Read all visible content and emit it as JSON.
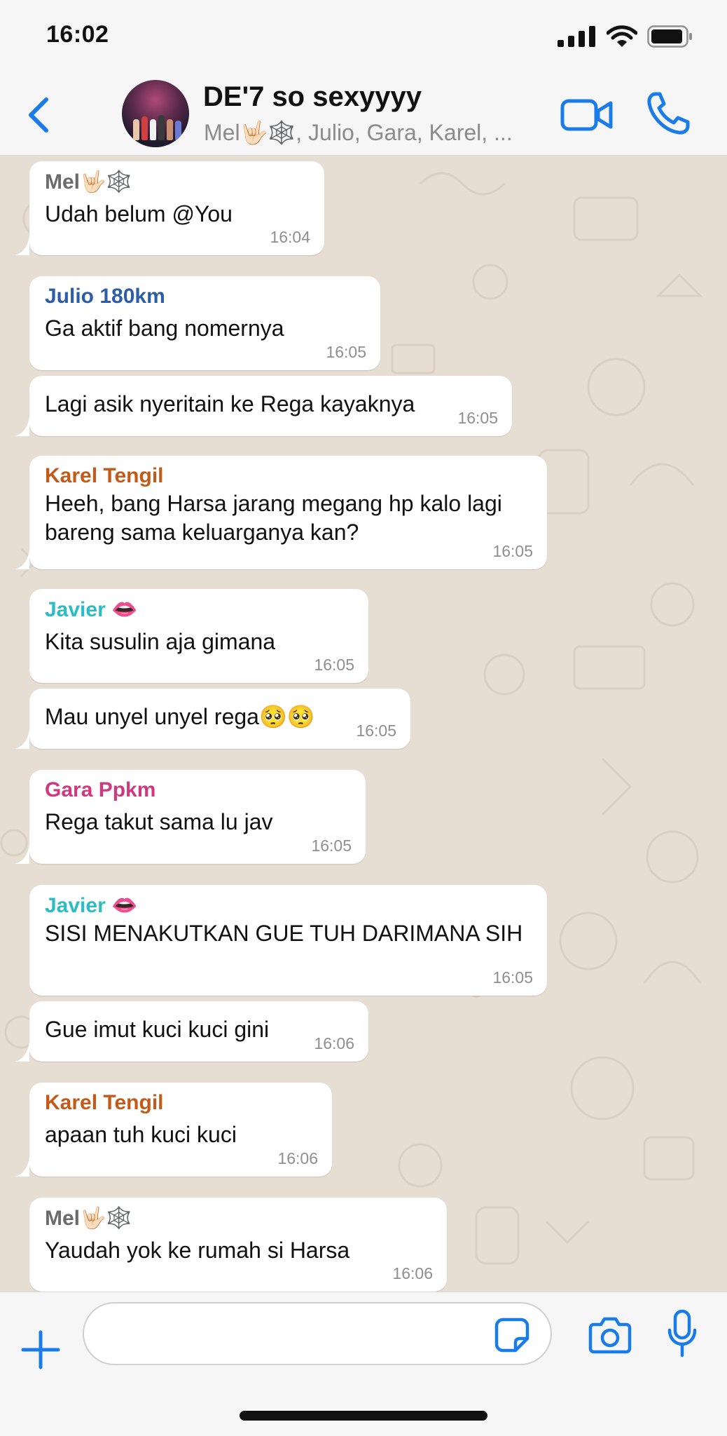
{
  "status_bar": {
    "time": "16:02"
  },
  "header": {
    "title": "DE'7 so sexyyyy",
    "members": "Mel🤟🏻🕸️, Julio, Gara, Karel, ..."
  },
  "colors": {
    "accent": "#1a7ce8",
    "chat_background": "#e6ddd3",
    "bubble": "#ffffff",
    "sender_mel": "#6b6b6b",
    "sender_julio": "#2d5da6",
    "sender_karel": "#c25a19",
    "sender_javier": "#2bbcc5",
    "sender_gara": "#d0397f"
  },
  "messages": [
    {
      "sender": "Mel🤟🏻🕸️",
      "text": "Udah belum @You",
      "time": "16:04"
    },
    {
      "sender": "Julio 180km",
      "text": "Ga aktif bang nomernya",
      "time": "16:05"
    },
    {
      "sender": "",
      "text": "Lagi asik nyeritain ke Rega kayaknya",
      "time": "16:05"
    },
    {
      "sender": "Karel Tengil",
      "text": "Heeh, bang Harsa jarang megang hp kalo lagi bareng sama keluarganya kan?",
      "time": "16:05"
    },
    {
      "sender": "Javier 👄",
      "text": "Kita susulin aja gimana",
      "time": "16:05"
    },
    {
      "sender": "",
      "text": "Mau unyel unyel rega🥺🥺",
      "time": "16:05"
    },
    {
      "sender": "Gara Ppkm",
      "text": "Rega takut sama lu jav",
      "time": "16:05"
    },
    {
      "sender": "Javier 👄",
      "text": "SISI MENAKUTKAN GUE TUH DARIMANA SIH",
      "time": "16:05"
    },
    {
      "sender": "",
      "text": "Gue imut kuci kuci gini",
      "time": "16:06"
    },
    {
      "sender": "Karel Tengil",
      "text": "apaan tuh kuci kuci",
      "time": "16:06"
    },
    {
      "sender": "Mel🤟🏻🕸️",
      "text": "Yaudah yok ke rumah si Harsa",
      "time": "16:06"
    }
  ],
  "input": {
    "value": "",
    "placeholder": ""
  },
  "icons": {
    "back": "chevron-left-icon",
    "video": "video-camera-icon",
    "call": "phone-icon",
    "plus": "plus-icon",
    "sticker": "sticker-icon",
    "camera": "camera-icon",
    "mic": "microphone-icon"
  }
}
